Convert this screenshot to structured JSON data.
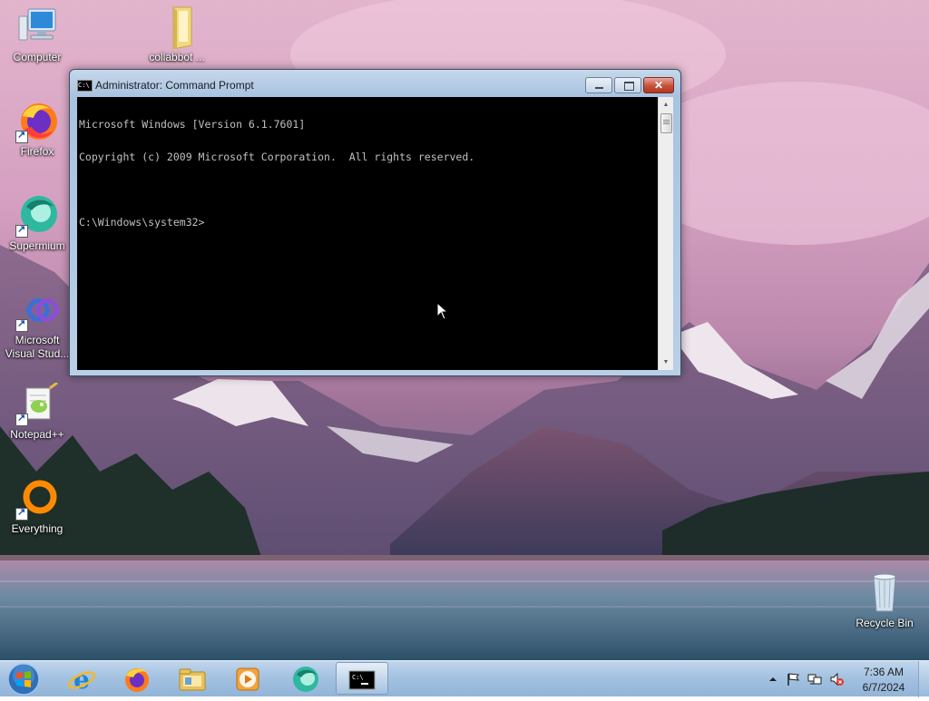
{
  "desktop": {
    "icons": [
      {
        "label": "Computer"
      },
      {
        "label": "collabbot ..."
      },
      {
        "label": "Firefox"
      },
      {
        "label": "Supermium"
      },
      {
        "label": "Microsoft Visual Stud..."
      },
      {
        "label": "Notepad++"
      },
      {
        "label": "Everything"
      },
      {
        "label": "Recycle Bin"
      }
    ]
  },
  "window": {
    "title": "Administrator: Command Prompt",
    "title_icon_text": "C:\\",
    "console_lines": [
      "Microsoft Windows [Version 6.1.7601]",
      "Copyright (c) 2009 Microsoft Corporation.  All rights reserved.",
      "",
      "C:\\Windows\\system32>"
    ]
  },
  "taskbar": {
    "apps": [
      {
        "icon": "internet-explorer-icon"
      },
      {
        "icon": "firefox-icon"
      },
      {
        "icon": "file-explorer-icon"
      },
      {
        "icon": "media-player-icon"
      },
      {
        "icon": "supermium-icon"
      },
      {
        "icon": "command-prompt-icon",
        "active": true
      }
    ],
    "tray": {
      "time": "7:36 AM",
      "date": "6/7/2024"
    }
  },
  "colors": {
    "console_bg": "#000000",
    "console_fg": "#c0c0c0",
    "close_button": "#c7503a",
    "taskbar": "#a4c2e1"
  }
}
